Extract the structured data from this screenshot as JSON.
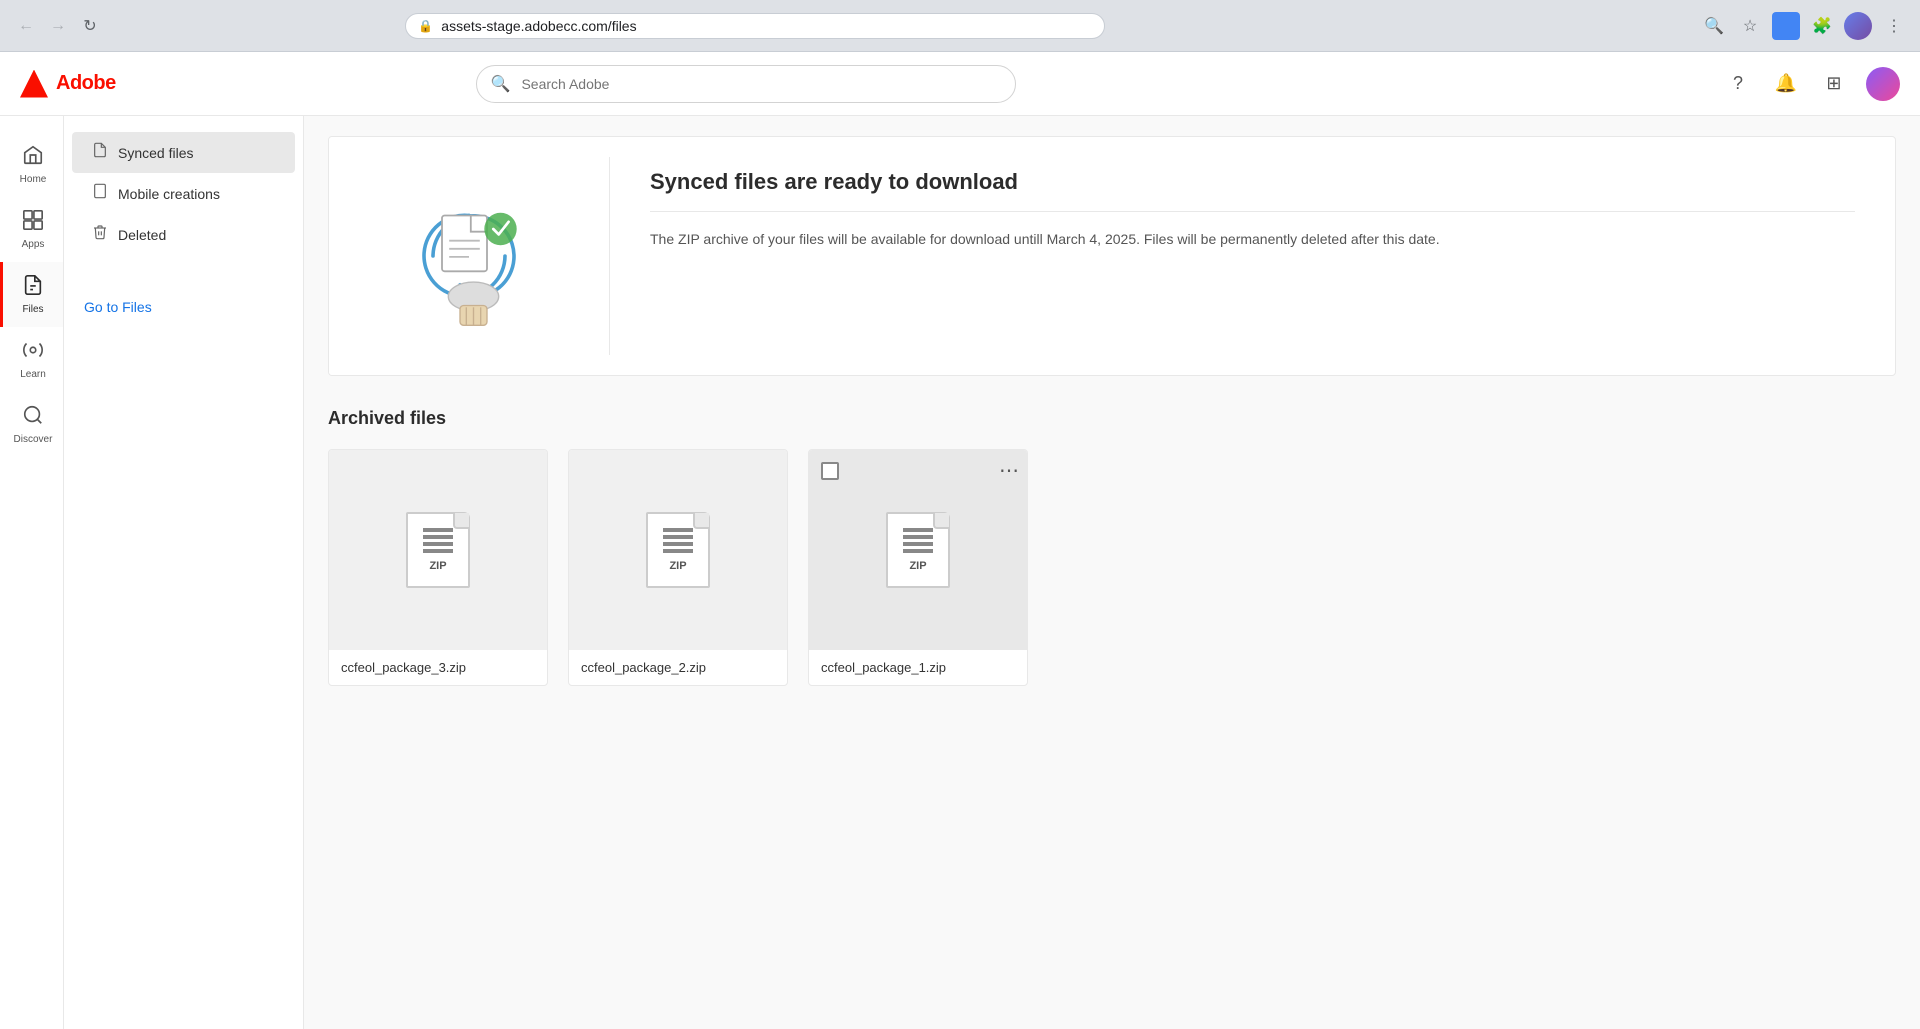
{
  "browser": {
    "url": "assets-stage.adobecc.com/files",
    "back_disabled": true,
    "forward_disabled": true
  },
  "header": {
    "logo_text": "Adobe",
    "search_placeholder": "Search Adobe"
  },
  "icon_sidebar": {
    "items": [
      {
        "id": "home",
        "label": "Home",
        "icon": "⌂",
        "active": false
      },
      {
        "id": "apps",
        "label": "Apps",
        "icon": "⊞",
        "active": false
      },
      {
        "id": "files",
        "label": "Files",
        "icon": "📄",
        "active": true
      },
      {
        "id": "learn",
        "label": "Learn",
        "icon": "💡",
        "active": false
      },
      {
        "id": "discover",
        "label": "Discover",
        "icon": "🔭",
        "active": false
      }
    ]
  },
  "file_sidebar": {
    "items": [
      {
        "id": "synced",
        "label": "Synced files",
        "icon": "📄",
        "active": true
      },
      {
        "id": "mobile",
        "label": "Mobile creations",
        "icon": "📱",
        "active": false
      },
      {
        "id": "deleted",
        "label": "Deleted",
        "icon": "🗑",
        "active": false
      }
    ],
    "go_to_files": "Go to Files"
  },
  "banner": {
    "title": "Synced files are ready to download",
    "description": "The ZIP archive of your files will be available for download untill March 4, 2025. Files will be permanently deleted after this date."
  },
  "archived": {
    "section_title": "Archived files",
    "files": [
      {
        "id": "pkg3",
        "name": "ccfeol_package_3.zip",
        "highlighted": false,
        "show_more": false,
        "show_checkbox": false
      },
      {
        "id": "pkg2",
        "name": "ccfeol_package_2.zip",
        "highlighted": false,
        "show_more": false,
        "show_checkbox": false
      },
      {
        "id": "pkg1",
        "name": "ccfeol_package_1.zip",
        "highlighted": true,
        "show_more": true,
        "show_checkbox": true
      }
    ]
  }
}
